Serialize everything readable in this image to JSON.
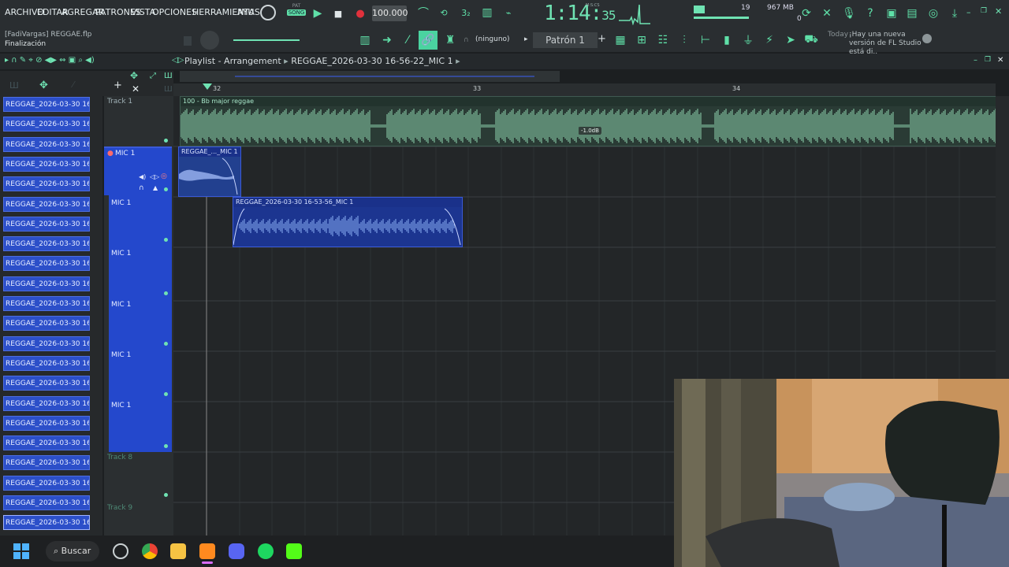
{
  "menu": [
    "ARCHIVO",
    "EDITAR",
    "AGREGAR",
    "PATRONES",
    "VISTA",
    "OPCIONES",
    "HERRAMIENTAS",
    "AYU"
  ],
  "transport": {
    "mode_top": "PAT",
    "mode_bottom": "SONG",
    "tempo": "100.000",
    "time_main": "1:14:",
    "time_small": "35",
    "mscs": "M:S:CS",
    "cpu": "19",
    "mem": "967 MB",
    "mem2": "0"
  },
  "project": {
    "user_file": "[FadiVargas] REGGAE.flp",
    "status": "Finalización"
  },
  "toolbar": {
    "snap": "(ninguno)",
    "pattern": "Patrón 1"
  },
  "notice": {
    "when": "Today",
    "text": "¡Hay una nueva versión de FL Studio está di.."
  },
  "playlist": {
    "title": "Playlist - Arrangement",
    "breadcrumb": "REGGAE_2026-03-30 16-56-22_MIC 1"
  },
  "ruler": {
    "bars": [
      "32",
      "33",
      "34"
    ]
  },
  "browser_items": [
    "REGGAE_2026-03-30 16-...",
    "REGGAE_2026-03-30 16-...",
    "REGGAE_2026-03-30 16-...",
    "REGGAE_2026-03-30 16-...",
    "REGGAE_2026-03-30 16-...",
    "REGGAE_2026-03-30 16-...",
    "REGGAE_2026-03-30 16-...",
    "REGGAE_2026-03-30 16-...",
    "REGGAE_2026-03-30 16-...",
    "REGGAE_2026-03-30 16-...",
    "REGGAE_2026-03-30 16-...",
    "REGGAE_2026-03-30 16-...",
    "REGGAE_2026-03-30 16-...",
    "REGGAE_2026-03-30 16-...",
    "REGGAE_2026-03-30 16-...",
    "REGGAE_2026-03-30 16-...",
    "REGGAE_2026-03-30 16-...",
    "REGGAE_2026-03-30 16-...",
    "REGGAE_2026-03-30 16-...",
    "REGGAE_2026-03-30 16-...",
    "REGGAE_2026-03-30 16-...",
    "REGGAE_2026-03-30 16-..."
  ],
  "tracks": [
    "Track 1",
    "MIC 1",
    "MIC 1",
    "MIC 1",
    "MIC 1",
    "MIC 1",
    "MIC 1",
    "Track 8",
    "Track 9"
  ],
  "clips": {
    "track1": "100 - Bb major reggae",
    "track1_gain": "-1.0dB",
    "mic_clip_a": "REGGAE_..._MIC 1",
    "mic_clip_b": "REGGAE_2026-03-30 16-53-56_MIC 1"
  },
  "taskbar": {
    "search": "Buscar"
  },
  "colors": {
    "accent": "#6fe3b3",
    "clip_blue": "#2448cc",
    "track_wave": "#8fd6b0"
  }
}
